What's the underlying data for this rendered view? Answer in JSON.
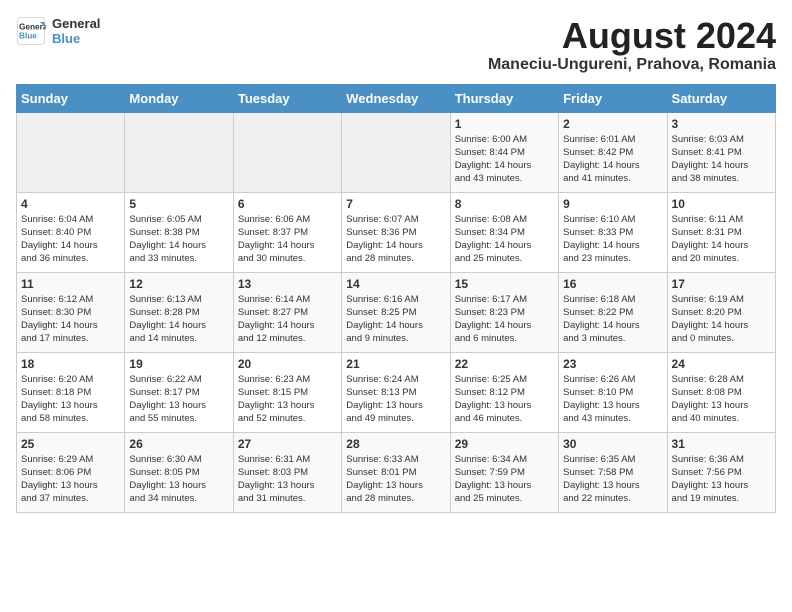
{
  "logo": {
    "line1": "General",
    "line2": "Blue"
  },
  "title": "August 2024",
  "location": "Maneciu-Ungureni, Prahova, Romania",
  "days_of_week": [
    "Sunday",
    "Monday",
    "Tuesday",
    "Wednesday",
    "Thursday",
    "Friday",
    "Saturday"
  ],
  "weeks": [
    [
      {
        "day": "",
        "info": ""
      },
      {
        "day": "",
        "info": ""
      },
      {
        "day": "",
        "info": ""
      },
      {
        "day": "",
        "info": ""
      },
      {
        "day": "1",
        "info": "Sunrise: 6:00 AM\nSunset: 8:44 PM\nDaylight: 14 hours\nand 43 minutes."
      },
      {
        "day": "2",
        "info": "Sunrise: 6:01 AM\nSunset: 8:42 PM\nDaylight: 14 hours\nand 41 minutes."
      },
      {
        "day": "3",
        "info": "Sunrise: 6:03 AM\nSunset: 8:41 PM\nDaylight: 14 hours\nand 38 minutes."
      }
    ],
    [
      {
        "day": "4",
        "info": "Sunrise: 6:04 AM\nSunset: 8:40 PM\nDaylight: 14 hours\nand 36 minutes."
      },
      {
        "day": "5",
        "info": "Sunrise: 6:05 AM\nSunset: 8:38 PM\nDaylight: 14 hours\nand 33 minutes."
      },
      {
        "day": "6",
        "info": "Sunrise: 6:06 AM\nSunset: 8:37 PM\nDaylight: 14 hours\nand 30 minutes."
      },
      {
        "day": "7",
        "info": "Sunrise: 6:07 AM\nSunset: 8:36 PM\nDaylight: 14 hours\nand 28 minutes."
      },
      {
        "day": "8",
        "info": "Sunrise: 6:08 AM\nSunset: 8:34 PM\nDaylight: 14 hours\nand 25 minutes."
      },
      {
        "day": "9",
        "info": "Sunrise: 6:10 AM\nSunset: 8:33 PM\nDaylight: 14 hours\nand 23 minutes."
      },
      {
        "day": "10",
        "info": "Sunrise: 6:11 AM\nSunset: 8:31 PM\nDaylight: 14 hours\nand 20 minutes."
      }
    ],
    [
      {
        "day": "11",
        "info": "Sunrise: 6:12 AM\nSunset: 8:30 PM\nDaylight: 14 hours\nand 17 minutes."
      },
      {
        "day": "12",
        "info": "Sunrise: 6:13 AM\nSunset: 8:28 PM\nDaylight: 14 hours\nand 14 minutes."
      },
      {
        "day": "13",
        "info": "Sunrise: 6:14 AM\nSunset: 8:27 PM\nDaylight: 14 hours\nand 12 minutes."
      },
      {
        "day": "14",
        "info": "Sunrise: 6:16 AM\nSunset: 8:25 PM\nDaylight: 14 hours\nand 9 minutes."
      },
      {
        "day": "15",
        "info": "Sunrise: 6:17 AM\nSunset: 8:23 PM\nDaylight: 14 hours\nand 6 minutes."
      },
      {
        "day": "16",
        "info": "Sunrise: 6:18 AM\nSunset: 8:22 PM\nDaylight: 14 hours\nand 3 minutes."
      },
      {
        "day": "17",
        "info": "Sunrise: 6:19 AM\nSunset: 8:20 PM\nDaylight: 14 hours\nand 0 minutes."
      }
    ],
    [
      {
        "day": "18",
        "info": "Sunrise: 6:20 AM\nSunset: 8:18 PM\nDaylight: 13 hours\nand 58 minutes."
      },
      {
        "day": "19",
        "info": "Sunrise: 6:22 AM\nSunset: 8:17 PM\nDaylight: 13 hours\nand 55 minutes."
      },
      {
        "day": "20",
        "info": "Sunrise: 6:23 AM\nSunset: 8:15 PM\nDaylight: 13 hours\nand 52 minutes."
      },
      {
        "day": "21",
        "info": "Sunrise: 6:24 AM\nSunset: 8:13 PM\nDaylight: 13 hours\nand 49 minutes."
      },
      {
        "day": "22",
        "info": "Sunrise: 6:25 AM\nSunset: 8:12 PM\nDaylight: 13 hours\nand 46 minutes."
      },
      {
        "day": "23",
        "info": "Sunrise: 6:26 AM\nSunset: 8:10 PM\nDaylight: 13 hours\nand 43 minutes."
      },
      {
        "day": "24",
        "info": "Sunrise: 6:28 AM\nSunset: 8:08 PM\nDaylight: 13 hours\nand 40 minutes."
      }
    ],
    [
      {
        "day": "25",
        "info": "Sunrise: 6:29 AM\nSunset: 8:06 PM\nDaylight: 13 hours\nand 37 minutes."
      },
      {
        "day": "26",
        "info": "Sunrise: 6:30 AM\nSunset: 8:05 PM\nDaylight: 13 hours\nand 34 minutes."
      },
      {
        "day": "27",
        "info": "Sunrise: 6:31 AM\nSunset: 8:03 PM\nDaylight: 13 hours\nand 31 minutes."
      },
      {
        "day": "28",
        "info": "Sunrise: 6:33 AM\nSunset: 8:01 PM\nDaylight: 13 hours\nand 28 minutes."
      },
      {
        "day": "29",
        "info": "Sunrise: 6:34 AM\nSunset: 7:59 PM\nDaylight: 13 hours\nand 25 minutes."
      },
      {
        "day": "30",
        "info": "Sunrise: 6:35 AM\nSunset: 7:58 PM\nDaylight: 13 hours\nand 22 minutes."
      },
      {
        "day": "31",
        "info": "Sunrise: 6:36 AM\nSunset: 7:56 PM\nDaylight: 13 hours\nand 19 minutes."
      }
    ]
  ]
}
